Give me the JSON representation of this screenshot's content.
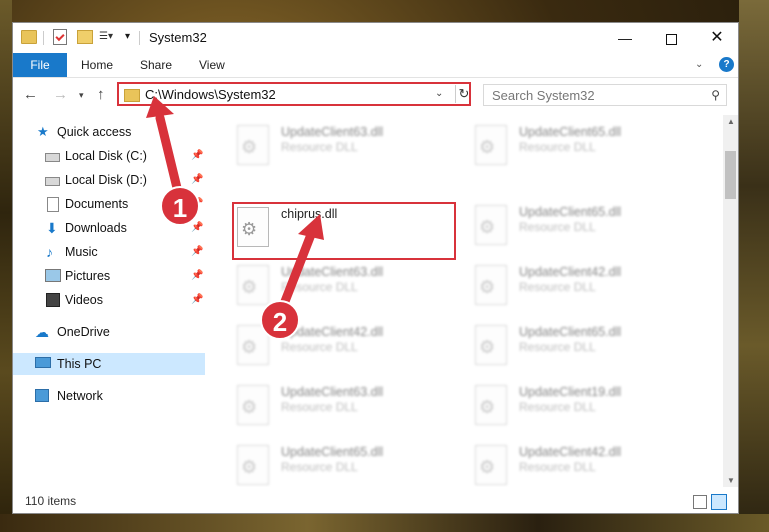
{
  "window": {
    "title": "System32",
    "minimize": "—",
    "close": "✕"
  },
  "ribbon": {
    "tabs": [
      {
        "label": "File"
      },
      {
        "label": "Home"
      },
      {
        "label": "Share"
      },
      {
        "label": "View"
      }
    ],
    "help": "?"
  },
  "address": {
    "path": "C:\\Windows\\System32",
    "search_placeholder": "Search System32"
  },
  "sidebar": {
    "items": [
      {
        "label": "Quick access",
        "icon": "star-icon"
      },
      {
        "label": "Local Disk (C:)",
        "icon": "disk-icon",
        "pinned": true
      },
      {
        "label": "Local Disk (D:)",
        "icon": "disk-icon",
        "pinned": true
      },
      {
        "label": "Documents",
        "icon": "documents-icon",
        "pinned": true
      },
      {
        "label": "Downloads",
        "icon": "downloads-icon",
        "pinned": true
      },
      {
        "label": "Music",
        "icon": "music-icon",
        "pinned": true
      },
      {
        "label": "Pictures",
        "icon": "pictures-icon",
        "pinned": true
      },
      {
        "label": "Videos",
        "icon": "videos-icon",
        "pinned": true
      },
      {
        "label": "OneDrive",
        "icon": "onedrive-icon"
      },
      {
        "label": "This PC",
        "icon": "pc-icon",
        "selected": true
      },
      {
        "label": "Network",
        "icon": "network-icon"
      }
    ]
  },
  "files": {
    "left": [
      {
        "name": "UpdateClient63.dll",
        "type": "Resource DLL"
      },
      {
        "name": "chiprus.dll",
        "type": ""
      },
      {
        "name": "UpdateClient63.dll",
        "type": "Resource DLL"
      },
      {
        "name": "UpdateClient42.dll",
        "type": "Resource DLL"
      },
      {
        "name": "UpdateClient63.dll",
        "type": "Resource DLL"
      },
      {
        "name": "UpdateClient65.dll",
        "type": "Resource DLL"
      }
    ],
    "right": [
      {
        "name": "UpdateClient65.dll",
        "type": "Resource DLL"
      },
      {
        "name": "UpdateClient65.dll",
        "type": "Resource DLL"
      },
      {
        "name": "UpdateClient42.dll",
        "type": "Resource DLL"
      },
      {
        "name": "UpdateClient65.dll",
        "type": "Resource DLL"
      },
      {
        "name": "UpdateClient19.dll",
        "type": "Resource DLL"
      },
      {
        "name": "UpdateClient42.dll",
        "type": "Resource DLL"
      }
    ]
  },
  "status": {
    "count": "110 items"
  },
  "annotations": {
    "step1": "1",
    "step2": "2"
  },
  "colors": {
    "accent": "#1979ca",
    "highlight": "#d8323b",
    "selected_bg": "#cce8ff"
  }
}
